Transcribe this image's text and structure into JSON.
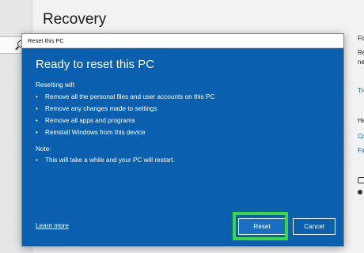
{
  "background": {
    "title": "Recovery",
    "right_fragments": [
      "Fix",
      "Re",
      "ne",
      "Tro",
      "He",
      "Cr",
      "Fir"
    ]
  },
  "dialog": {
    "window_title": "Reset this PC",
    "heading": "Ready to reset this PC",
    "resetting_label": "Resetting will:",
    "items": [
      "Remove all the personal files and user accounts on this PC",
      "Remove any changes made to settings",
      "Remove all apps and programs",
      "Reinstall Windows from this device"
    ],
    "note_label": "Note:",
    "note_items": [
      "This will take a while and your PC will restart."
    ],
    "learn_more": "Learn more",
    "reset_button": "Reset",
    "cancel_button": "Cancel"
  },
  "colors": {
    "dialog_bg": "#0a5fae",
    "highlight": "#3dd63d",
    "link": "#0063b1"
  }
}
